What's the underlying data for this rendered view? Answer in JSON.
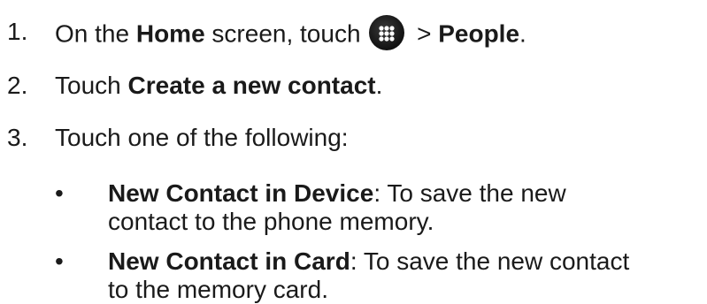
{
  "steps": [
    {
      "number": "1.",
      "prefix": "On the ",
      "home": "Home",
      "middle": " screen, touch ",
      "icon": "apps-grid-icon",
      "gt": " > ",
      "people": "People",
      "end": "."
    },
    {
      "number": "2.",
      "prefix": "Touch ",
      "bold": "Create a new contact",
      "end": "."
    },
    {
      "number": "3.",
      "text": "Touch one of the following:"
    }
  ],
  "options": [
    {
      "bullet": "•",
      "bold": "New Contact in Device",
      "rest_line1": ": To save the new",
      "line2": "contact to the phone memory."
    },
    {
      "bullet": "•",
      "bold": "New Contact in Card",
      "rest_line1": ": To save the new contact",
      "line2": "to the memory card."
    }
  ]
}
